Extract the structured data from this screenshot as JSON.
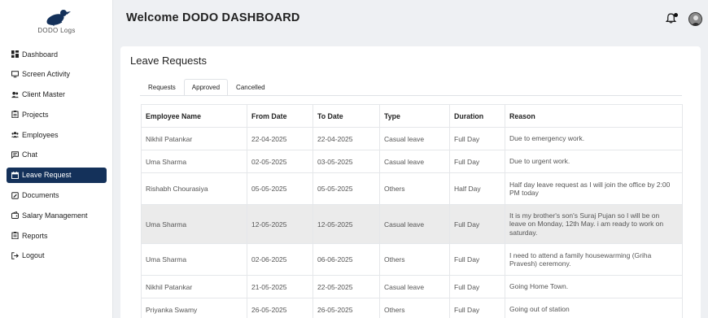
{
  "brand": {
    "logo_text": "DODO Logs"
  },
  "sidebar": {
    "items": [
      {
        "label": "Dashboard",
        "icon": "dashboard-icon"
      },
      {
        "label": "Screen Activity",
        "icon": "monitor-icon"
      },
      {
        "label": "Client Master",
        "icon": "clients-icon"
      },
      {
        "label": "Projects",
        "icon": "clipboard-icon"
      },
      {
        "label": "Employees",
        "icon": "group-icon"
      },
      {
        "label": "Chat",
        "icon": "chat-icon"
      },
      {
        "label": "Leave Request",
        "icon": "calendar-icon",
        "active": true
      },
      {
        "label": "Documents",
        "icon": "document-icon"
      },
      {
        "label": "Salary Management",
        "icon": "wallet-icon"
      },
      {
        "label": "Reports",
        "icon": "report-icon"
      },
      {
        "label": "Logout",
        "icon": "logout-icon"
      }
    ]
  },
  "header": {
    "title": "Welcome DODO DASHBOARD"
  },
  "main": {
    "title": "Leave Requests",
    "tabs": [
      {
        "label": "Requests"
      },
      {
        "label": "Approved",
        "active": true
      },
      {
        "label": "Cancelled"
      }
    ],
    "columns": [
      "Employee Name",
      "From Date",
      "To Date",
      "Type",
      "Duration",
      "Reason"
    ],
    "rows": [
      [
        "Nikhil Patankar",
        "22-04-2025",
        "22-04-2025",
        "Casual leave",
        "Full Day",
        "Due to emergency work."
      ],
      [
        "Uma Sharma",
        "02-05-2025",
        "03-05-2025",
        "Casual leave",
        "Full Day",
        "Due to urgent work."
      ],
      [
        "Rishabh Chourasiya",
        "05-05-2025",
        "05-05-2025",
        "Others",
        "Half Day",
        "Half day leave request as I will join the office by 2:00 PM today"
      ],
      [
        "Uma Sharma",
        "12-05-2025",
        "12-05-2025",
        "Casual leave",
        "Full Day",
        "It is my brother's son's Suraj Pujan so I will be on leave on Monday, 12th May. i am ready to work on saturday."
      ],
      [
        "Uma Sharma",
        "02-06-2025",
        "06-06-2025",
        "Others",
        "Full Day",
        "I need to attend a family housewarming (Griha Pravesh) ceremony."
      ],
      [
        "Nikhil Patankar",
        "21-05-2025",
        "22-05-2025",
        "Casual leave",
        "Full Day",
        "Going Home Town."
      ],
      [
        "Priyanka Swamy",
        "26-05-2025",
        "26-05-2025",
        "Others",
        "Full Day",
        "Going out of station"
      ]
    ]
  },
  "colors": {
    "sidebar_active": "#14315a",
    "shaded_row": "#ebebeb"
  }
}
